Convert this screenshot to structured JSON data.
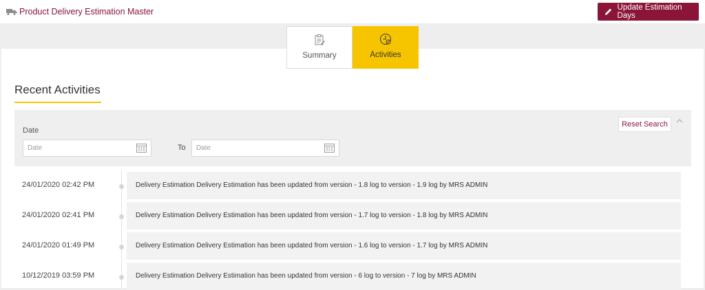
{
  "header": {
    "title": "Product Delivery Estimation Master",
    "update_button_label": "Update Estimation Days"
  },
  "tabs": [
    {
      "label": "Summary",
      "active": false
    },
    {
      "label": "Activities",
      "active": true
    }
  ],
  "section": {
    "title": "Recent Activities"
  },
  "search": {
    "date_label": "Date",
    "from_placeholder": "Date",
    "to_label": "To",
    "to_placeholder": "Date",
    "reset_label": "Reset Search"
  },
  "activities": [
    {
      "timestamp": "24/01/2020 02:42 PM",
      "message": "Delivery Estimation Delivery Estimation has been updated from version - 1.8 log to version - 1.9 log by MRS ADMIN"
    },
    {
      "timestamp": "24/01/2020 02:41 PM",
      "message": "Delivery Estimation Delivery Estimation has been updated from version - 1.7 log to version - 1.8 log by MRS ADMIN"
    },
    {
      "timestamp": "24/01/2020 01:49 PM",
      "message": "Delivery Estimation Delivery Estimation has been updated from version - 1.6 log to version - 1.7 log by MRS ADMIN"
    },
    {
      "timestamp": "10/12/2019 03:59 PM",
      "message": "Delivery Estimation Delivery Estimation has been updated from version - 6 log to version - 7 log by MRS ADMIN"
    }
  ],
  "colors": {
    "brand": "#8a1538",
    "accent": "#f6c500"
  },
  "icons": {
    "header": "truck-icon",
    "update_button": "pencil-icon",
    "summary_tab": "clipboard-icon",
    "activities_tab": "clock-icon",
    "date_picker": "calendar-icon",
    "collapse": "chevron-up-icon"
  }
}
